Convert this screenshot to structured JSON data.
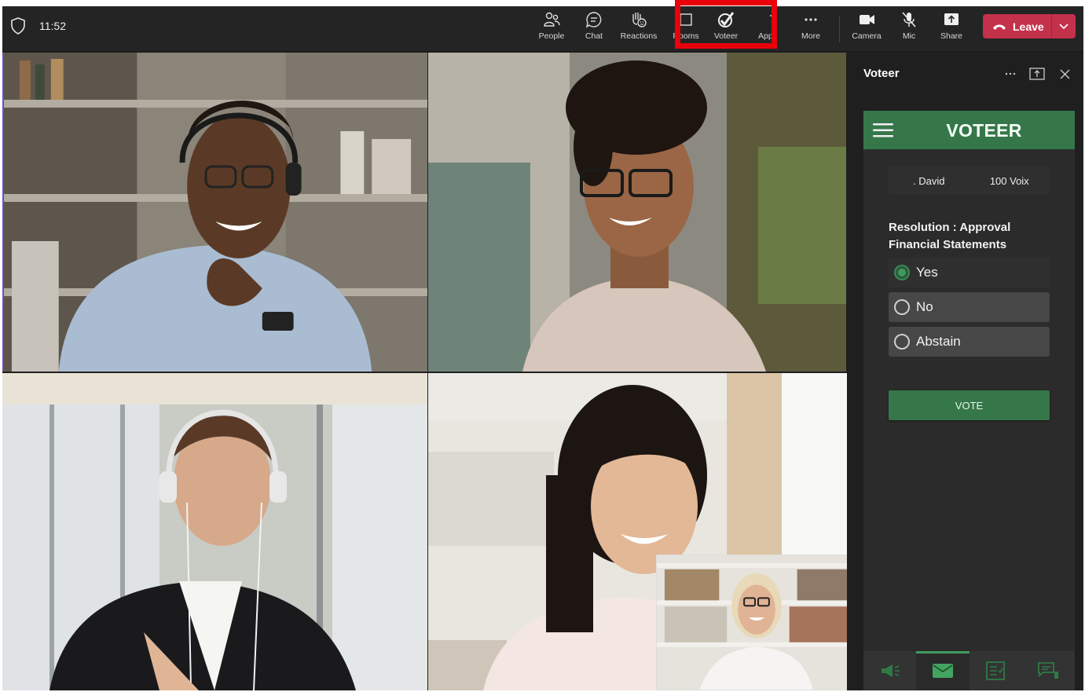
{
  "topbar": {
    "time": "11:52",
    "buttons": {
      "people": "People",
      "chat": "Chat",
      "reactions": "Reactions",
      "rooms": "Rooms",
      "voteer": "Voteer",
      "apps": "Apps",
      "more": "More",
      "camera": "Camera",
      "mic": "Mic",
      "share": "Share"
    },
    "leave_label": "Leave",
    "highlighted_button": "Voteer",
    "colors": {
      "leave": "#c4314b",
      "highlight": "#e8000b"
    }
  },
  "panel": {
    "title": "Voteer",
    "icons": [
      "more-options-icon",
      "pop-out-icon",
      "close-icon"
    ]
  },
  "app": {
    "brand": "VOTEER",
    "user_name": ". David",
    "votes": "100 Voix",
    "question": "Resolution : Approval Financial Statements",
    "options": [
      {
        "label": "Yes",
        "selected": true
      },
      {
        "label": "No",
        "selected": false
      },
      {
        "label": "Abstain",
        "selected": false
      }
    ],
    "vote_button": "VOTE",
    "nav": [
      {
        "icon": "megaphone-icon",
        "active": false
      },
      {
        "icon": "mail-icon",
        "active": true
      },
      {
        "icon": "checklist-icon",
        "active": false
      },
      {
        "icon": "chat-bubbles-icon",
        "active": false
      }
    ],
    "colors": {
      "brand_green": "#36774a"
    }
  },
  "participants": [
    {
      "tile": "top-left",
      "description": "man with headset and glasses"
    },
    {
      "tile": "top-right",
      "description": "woman with glasses and curly hair"
    },
    {
      "tile": "bottom-left",
      "description": "man with headphones writing"
    },
    {
      "tile": "bottom-right",
      "description": "smiling woman"
    },
    {
      "tile": "self-view",
      "description": "woman with blonde hair and glasses"
    }
  ]
}
